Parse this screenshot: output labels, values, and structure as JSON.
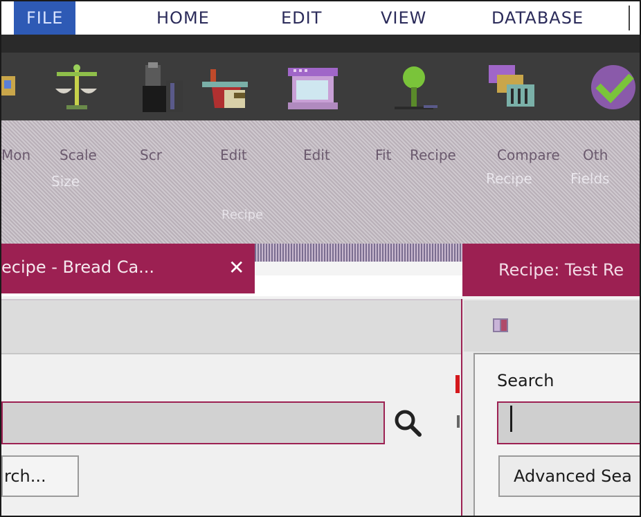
{
  "menubar": {
    "items": [
      "FILE",
      "HOME",
      "EDIT",
      "VIEW",
      "DATABASE"
    ],
    "active": "FILE"
  },
  "ribbon": {
    "icons": [
      "scale-icon",
      "scale-balance-icon",
      "containers-icon",
      "edit-recipe-icon",
      "edit-window-icon",
      "nutrient-icon",
      "compare-icon",
      "check-icon"
    ],
    "labels": [
      "Mon",
      "Scale",
      "Scr",
      "Edit",
      "Edit",
      "Fit",
      "Recipe",
      "Compare",
      "Oth"
    ],
    "sub_labels": [
      "Size",
      "Recipe",
      "Fields"
    ],
    "group_label": "Recipe"
  },
  "tabs": [
    {
      "label": "ecipe - Bread Ca...",
      "close": "✕"
    },
    {
      "label": "Recipe: Test Re"
    }
  ],
  "left_panel": {
    "search_value": "",
    "advanced_search_label": "rch..."
  },
  "right_panel": {
    "search_label": "Search",
    "search_value": "",
    "advanced_search_label": "Advanced Sea"
  },
  "colors": {
    "accent": "#9c2052",
    "menu_active": "#2e5ab5",
    "ribbon_dark": "#3c3c3c"
  }
}
